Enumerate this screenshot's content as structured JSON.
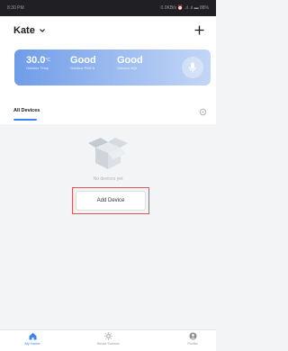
{
  "status_bar": {
    "time": "8:30 PM",
    "right": "0.0KB/s ⏰ .ıl .ıl ▬ 88%"
  },
  "header": {
    "home_name": "Kate",
    "add_icon": "plus-icon",
    "home_menu_icon": "chevron-down-icon"
  },
  "weather": {
    "temp_value": "30.0",
    "temp_unit": "°C",
    "temp_label": "Outdoor Temp",
    "pm_value": "Good",
    "pm_label": "Outdoor PM2.5",
    "aqi_value": "Good",
    "aqi_label": "Outdoor AQI",
    "mic_icon": "microphone-icon",
    "colors": {
      "start": "#6f9ce8",
      "end": "#c3d6f6"
    }
  },
  "tabs": {
    "active": "All Devices",
    "settings_icon": "settings-icon",
    "accent": "#3c82f5"
  },
  "empty_state": {
    "icon": "empty-box-icon",
    "text": "No devices yet",
    "button_label": "Add Device",
    "highlight_color": "#e05555"
  },
  "bottom_nav": [
    {
      "label": "My Home",
      "icon": "home-icon",
      "active": true
    },
    {
      "label": "Smart Scenes",
      "icon": "sun-icon",
      "active": false
    },
    {
      "label": "Profile",
      "icon": "profile-icon",
      "active": false
    }
  ]
}
